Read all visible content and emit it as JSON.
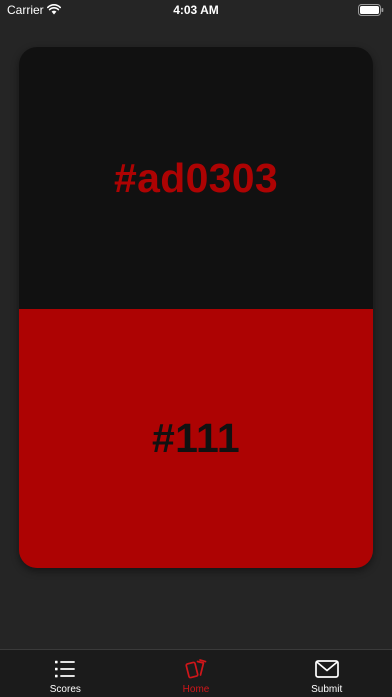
{
  "status_bar": {
    "carrier": "Carrier",
    "time": "4:03 AM",
    "wifi_icon": "wifi-icon",
    "battery_icon": "battery-icon"
  },
  "card": {
    "top_text": "#ad0303",
    "bottom_text": "#111",
    "top_background": "#111111",
    "top_text_color": "#ad0303",
    "bottom_background": "#ad0303",
    "bottom_text_color": "#111111"
  },
  "tab_bar": {
    "active_color": "#d0161a",
    "inactive_color": "#ffffff",
    "tabs": [
      {
        "label": "Scores",
        "icon": "list-icon",
        "active": false
      },
      {
        "label": "Home",
        "icon": "cards-icon",
        "active": true
      },
      {
        "label": "Submit",
        "icon": "envelope-icon",
        "active": false
      }
    ]
  }
}
